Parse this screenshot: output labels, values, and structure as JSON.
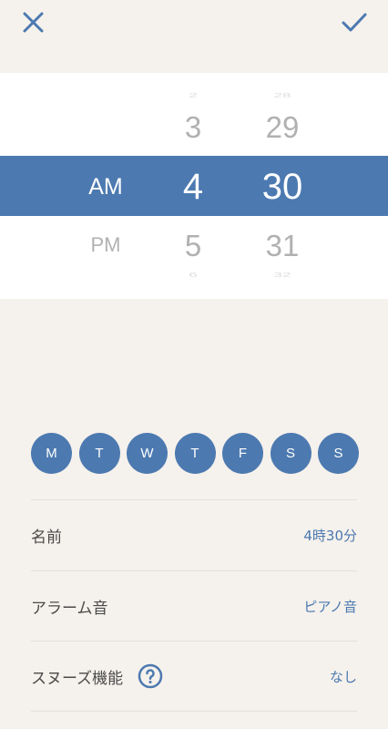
{
  "header": {
    "close_icon": "close-icon",
    "confirm_icon": "check-icon",
    "accent_color": "#4c79b0"
  },
  "time_picker": {
    "ampm": {
      "above": "",
      "selected": "AM",
      "below": "PM"
    },
    "hour": {
      "ghost_above": "2",
      "above": "3",
      "selected": "4",
      "below": "5",
      "ghost_below": "6"
    },
    "minute": {
      "ghost_above": "28",
      "above": "29",
      "selected": "30",
      "below": "31",
      "ghost_below": "32"
    }
  },
  "weekdays": [
    "M",
    "T",
    "W",
    "T",
    "F",
    "S",
    "S"
  ],
  "settings": {
    "name": {
      "label": "名前",
      "value": "4時30分"
    },
    "sound": {
      "label": "アラーム音",
      "value": "ピアノ音"
    },
    "snooze": {
      "label": "スヌーズ機能",
      "value": "なし",
      "help_icon": "help-icon"
    }
  }
}
